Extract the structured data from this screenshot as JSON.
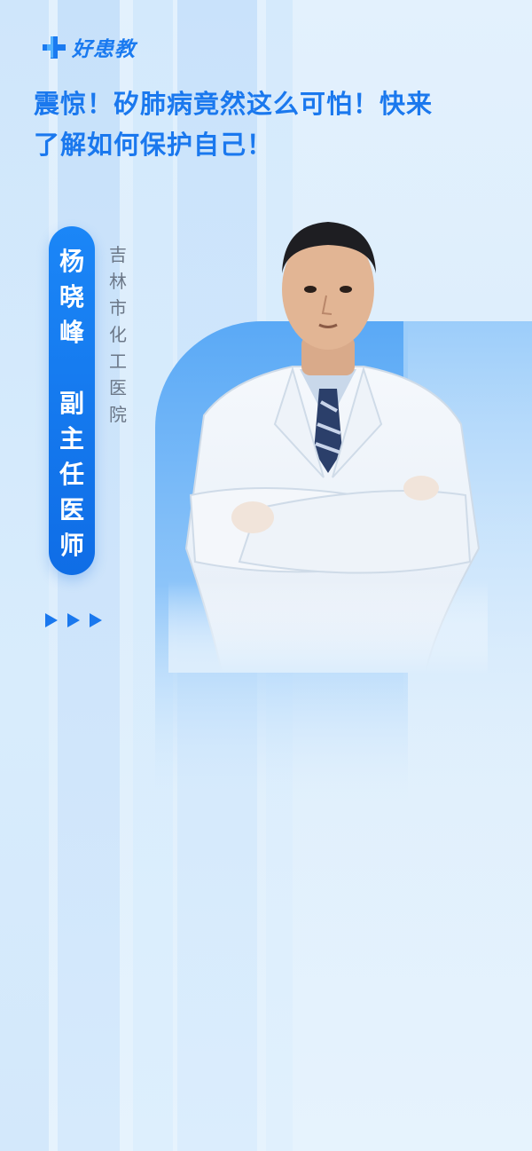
{
  "brand": {
    "name": "好患教",
    "logo_icon": "plus-cross-icon",
    "accent": "#1a7af0"
  },
  "headline": {
    "line1": "震惊！矽肺病竟然这么可怕！快来",
    "line2": "了解如何保护自己！"
  },
  "doctor": {
    "name_chars": [
      "杨",
      "晓",
      "峰"
    ],
    "title_chars": [
      "副",
      "主",
      "任",
      "医",
      "师"
    ],
    "hospital_chars": [
      "吉",
      "林",
      "市",
      "化",
      "工",
      "医",
      "院"
    ]
  },
  "decor": {
    "arrow_icon": "triangle-right-icon",
    "arrow_count": 3
  },
  "colors": {
    "primary": "#1a78ee",
    "background": "#e3f1fd",
    "pill": "#1479ee"
  }
}
